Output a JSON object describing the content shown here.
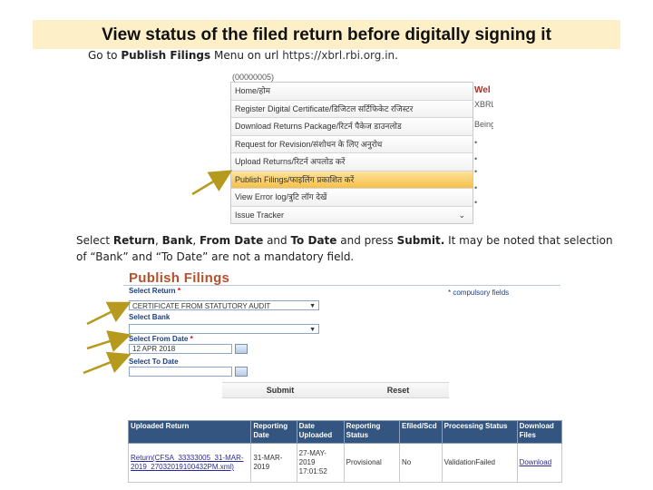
{
  "slide": {
    "title": "View status of the filed return before digitally signing it",
    "step1": {
      "prefix": "Go to ",
      "menu_name": "Publish Filings",
      "middle": " Menu on url ",
      "url": "https://xbrl.rbi.org.in",
      "suffix": "."
    },
    "step2": {
      "t1": "Select ",
      "b1": "Return",
      "t2": ", ",
      "b2": "Bank",
      "t3": ", ",
      "b3": "From Date",
      "t4": " and ",
      "b4": "To Date",
      "t5": " and press ",
      "b5": "Submit.",
      "t6": " It may be noted that selection of “Bank” and “To Date” are not a mandatory field."
    }
  },
  "menu_screenshot": {
    "top_text": "(00000005)",
    "items": [
      "Home/होम",
      "Register Digital Certificate/डिजिटल सर्टिफिकेट रजिस्टर",
      "Download Returns Package/रिटर्न पैकेज डाउनलोड",
      "Request for Revision/संशोधन के लिए अनुरोध",
      "Upload Returns/रिटर्न अपलोड करें",
      "Publish Filings/फाइलिंग प्रकाशित करें",
      "View Error log/त्रुटि लॉग देखें",
      "Issue Tracker"
    ],
    "active_index": 5,
    "side_texts": [
      "Wel",
      "XBRL",
      "Being"
    ]
  },
  "publish_form": {
    "title": "Publish Filings",
    "return_label": "Select Return",
    "return_value": "CERTIFICATE FROM STATUTORY AUDIT",
    "bank_label": "Select Bank",
    "bank_value": "",
    "from_date_label": "Select From Date",
    "from_date_value": "12 APR 2018",
    "to_date_label": "Select To Date",
    "to_date_value": "",
    "required_mark": "*",
    "compulsory_note": "* compulsory fields",
    "submit_label": "Submit",
    "reset_label": "Reset"
  },
  "results_table": {
    "headers": [
      "Uploaded Return",
      "Reporting Date",
      "Date Uploaded",
      "Reporting Status",
      "Efiled/Scd",
      "Processing Status",
      "Download Files"
    ],
    "rows": [
      [
        "Return(CFSA_33333005_31-MAR-2019_27032019100432PM.xml)",
        "31-MAR-2019",
        "27-MAY-2019 17:01:52",
        "Provisional",
        "No",
        "ValidationFailed",
        "Download"
      ]
    ]
  },
  "colors": {
    "banner_bg": "#fdf0c8",
    "form_title": "#b4502c",
    "label_blue": "#1d3f7e",
    "table_header": "#34557f",
    "active_menu": "#f5c04a",
    "arrow": "#b59a1e"
  }
}
